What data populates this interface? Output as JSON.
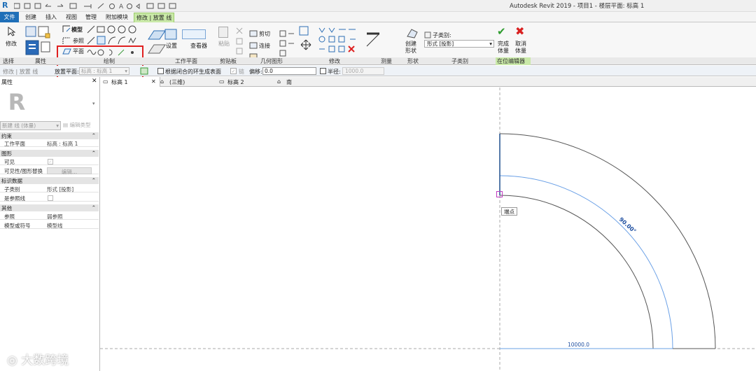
{
  "window": {
    "title": "Autodesk Revit 2019 - 项目1 - 楼层平面: 标高 1"
  },
  "tabs": [
    {
      "label": "文件"
    },
    {
      "label": "创建"
    },
    {
      "label": "插入"
    },
    {
      "label": "视图"
    },
    {
      "label": "管理"
    },
    {
      "label": "附加模块"
    },
    {
      "label": "修改 | 放置 线"
    }
  ],
  "ribbon": {
    "modify_label": "修改",
    "draw": {
      "model": "模型",
      "reference": "参照",
      "plane": "平面"
    },
    "workplane": {
      "set": "设置",
      "viewer": "查看器"
    },
    "clipboard": {
      "paste": "粘贴"
    },
    "geometry": {
      "cut": "剪切",
      "join": "连接"
    },
    "form": {
      "create_form": "创建\n形状"
    },
    "subcategory": {
      "label": "子类别:",
      "value": "形式 [投影]"
    },
    "inplace": {
      "finish": "完成\n体量",
      "cancel": "取消\n体量"
    },
    "panels": [
      "选择",
      "属性",
      "绘制",
      "工作平面",
      "剪贴板",
      "几何图形",
      "修改",
      "测量",
      "形状",
      "子类别",
      "在位编辑器"
    ]
  },
  "options_bar": {
    "modify_place": "修改 | 放置 线",
    "placement_plane_label": "放置平面:",
    "placement_plane_value": "标高 : 标高 1",
    "closed_loop_label": "根据闭合的环生成表面",
    "chain_label": "链",
    "offset_label": "偏移:",
    "offset_value": "0.0",
    "radius_label": "半径:",
    "radius_value": "1000.0"
  },
  "view_tabs": [
    {
      "label": "标高 1"
    },
    {
      "label": "(三维)"
    },
    {
      "label": "标高 2"
    },
    {
      "label": "南"
    }
  ],
  "properties": {
    "title": "属性",
    "type_selector": "新建 线 (体量)",
    "edit_type": "编辑类型",
    "sections": [
      {
        "name": "约束",
        "rows": [
          {
            "k": "工作平面",
            "v": "标高 : 标高 1"
          }
        ]
      },
      {
        "name": "图形",
        "rows": [
          {
            "k": "可见",
            "v": ""
          },
          {
            "k": "可见性/图形替换",
            "v": "编辑..."
          }
        ]
      },
      {
        "name": "标识数据",
        "rows": [
          {
            "k": "子类别",
            "v": "形式 [投影]"
          },
          {
            "k": "是参照线",
            "v": ""
          }
        ]
      },
      {
        "name": "其他",
        "rows": [
          {
            "k": "参照",
            "v": "弱参照"
          },
          {
            "k": "模型或符号",
            "v": "模型线"
          }
        ]
      }
    ]
  },
  "canvas": {
    "angle_label": "90.00°",
    "dimension_label": "10000.0",
    "snap_tooltip": "端点"
  },
  "watermark": "大数跨境"
}
